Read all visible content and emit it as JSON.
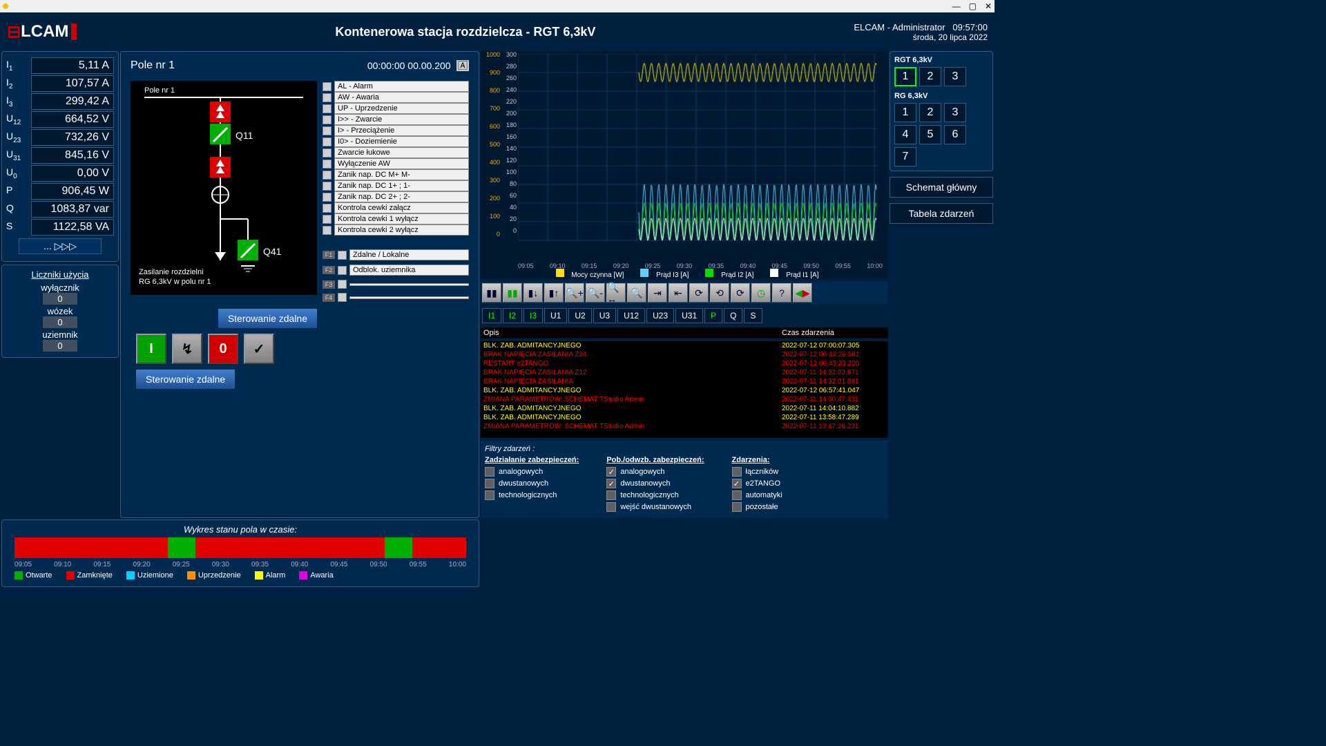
{
  "window": {
    "title": ""
  },
  "header": {
    "logo": "LCAM",
    "center": "Kontenerowa stacja rozdzielcza  - RGT 6,3kV",
    "user": "ELCAM - Administrator",
    "time": "09:57:00",
    "date": "środa, 20 lipca 2022"
  },
  "measurements": [
    {
      "lbl": "I",
      "sub": "1",
      "val": "5,11 A"
    },
    {
      "lbl": "I",
      "sub": "2",
      "val": "107,57 A"
    },
    {
      "lbl": "I",
      "sub": "3",
      "val": "299,42 A"
    },
    {
      "lbl": "U",
      "sub": "12",
      "val": "664,52 V"
    },
    {
      "lbl": "U",
      "sub": "23",
      "val": "732,26 V"
    },
    {
      "lbl": "U",
      "sub": "31",
      "val": "845,16 V"
    },
    {
      "lbl": "U",
      "sub": "0",
      "val": "0,00 V"
    },
    {
      "lbl": "P",
      "sub": "",
      "val": "906,45 W"
    },
    {
      "lbl": "Q",
      "sub": "",
      "val": "1083,87 var"
    },
    {
      "lbl": "S",
      "sub": "",
      "val": "1122,58 VA"
    }
  ],
  "more_btn": "... ▷▷▷",
  "liczniki": {
    "title": "Liczniki użycia",
    "items": [
      {
        "name": "wyłącznik",
        "val": "0"
      },
      {
        "name": "wózek",
        "val": "0"
      },
      {
        "name": "uziemnik",
        "val": "0"
      }
    ]
  },
  "pole": {
    "title": "Pole nr 1",
    "timer": "00:00:00  00.00.200",
    "sld_title": "Pole nr 1",
    "sld_sw1": "Q11",
    "sld_sw2": "Q41",
    "sld_caption1": "Zasilanie rozdzielni",
    "sld_caption2": "RG 6,3kV w polu nr 1",
    "signals": [
      "AL - Alarm",
      "AW - Awaria",
      "UP - Uprzedzenie",
      "I>> - Zwarcie",
      "I> - Przeciążenie",
      "I0> - Doziemienie",
      "Zwarcie łukowe",
      "Wyłączenie AW",
      "Zanik nap. DC  M+ M-",
      "Zanik nap. DC  1+ ; 1-",
      "Zanik nap. DC  2+ ; 2-",
      "Kontrola cewki załącz",
      "Kontrola cewki 1 wyłącz",
      "Kontrola cewki 2 wyłącz"
    ],
    "fkeys": [
      {
        "f": "F1",
        "txt": "Zdalne / Lokalne"
      },
      {
        "f": "F2",
        "txt": "Odblok. uziemnika"
      },
      {
        "f": "F3",
        "txt": ""
      },
      {
        "f": "F4",
        "txt": ""
      }
    ],
    "ctrl_btn1": "Sterowanie zdalne",
    "ctrl_btn2": "Sterowanie zdalne"
  },
  "timeline": {
    "title": "Wykres stanu pola w czasie:",
    "axis": [
      "09:05",
      "09:10",
      "09:15",
      "09:20",
      "09:25",
      "09:30",
      "09:35",
      "09:40",
      "09:45",
      "09:50",
      "09:55",
      "10:00"
    ],
    "legend": [
      {
        "c": "#00b000",
        "t": "Otwarte"
      },
      {
        "c": "#e00000",
        "t": "Zamknięte"
      },
      {
        "c": "#00d0ff",
        "t": "Uziemione"
      },
      {
        "c": "#ff9000",
        "t": "Uprzedzenie"
      },
      {
        "c": "#ffff00",
        "t": "Alarm"
      },
      {
        "c": "#e000e0",
        "t": "Awaria"
      }
    ],
    "segments": [
      {
        "c": "#e00000",
        "w": 34
      },
      {
        "c": "#00b000",
        "w": 6
      },
      {
        "c": "#e00000",
        "w": 42
      },
      {
        "c": "#00b000",
        "w": 6
      },
      {
        "c": "#e00000",
        "w": 12
      }
    ]
  },
  "chart_data": {
    "type": "line",
    "x_axis": [
      "09:05",
      "09:10",
      "09:15",
      "09:20",
      "09:25",
      "09:30",
      "09:35",
      "09:40",
      "09:45",
      "09:50",
      "09:55",
      "10:00"
    ],
    "y_left_ticks": [
      0,
      100,
      200,
      300,
      400,
      500,
      600,
      700,
      800,
      900,
      1000
    ],
    "y_right_ticks": [
      0,
      20,
      40,
      60,
      80,
      100,
      120,
      140,
      160,
      180,
      200,
      220,
      240,
      260,
      280,
      300
    ],
    "series": [
      {
        "name": "Mocy czynna [W]",
        "color": "#ffe000",
        "range": [
          850,
          950
        ]
      },
      {
        "name": "Prąd I3 [A]",
        "color": "#60d0ff",
        "range": [
          0,
          300
        ]
      },
      {
        "name": "Prąd I2 [A]",
        "color": "#00e000",
        "range": [
          0,
          200
        ]
      },
      {
        "name": "Prąd I1 [A]",
        "color": "#ffffff",
        "range": [
          0,
          120
        ]
      }
    ],
    "note": "oscillating waveforms from ~09:25 to 10:00"
  },
  "chart_legend": [
    {
      "c": "#ffe000",
      "t": "Mocy czynna [W]"
    },
    {
      "c": "#60d0ff",
      "t": "Prąd I3 [A]"
    },
    {
      "c": "#00e000",
      "t": "Prąd I2 [A]"
    },
    {
      "c": "#ffffff",
      "t": "Prąd I1 [A]"
    }
  ],
  "toolbar2": [
    "I1",
    "I2",
    "I3",
    "U1",
    "U2",
    "U3",
    "U12",
    "U23",
    "U31",
    "P",
    "Q",
    "S"
  ],
  "events": {
    "col1": "Opis",
    "col2": "Czas zdarzenia",
    "rows": [
      {
        "c": "y",
        "d": "BLK. ZAB. ADMITANCYJNEGO",
        "t": "2022-07-12 07:00:07.305"
      },
      {
        "c": "r",
        "d": "BRAK NAPIĘCIA ZASILANIA Z34",
        "t": "2022-07-12 06:43:26.581"
      },
      {
        "c": "r",
        "d": "RESTART e2TANGO",
        "t": "2022-07-12 06:43:23.220"
      },
      {
        "c": "r",
        "d": "BRAK NAPIĘCIA ZASILANIA Z12",
        "t": "2022-07-11 14:32:02.871"
      },
      {
        "c": "r",
        "d": "BRAK NAPIĘCIA ZASILANIA",
        "t": "2022-07-11 14:32:01.881"
      },
      {
        "c": "y",
        "d": "BLK. ZAB. ADMITANCYJNEGO",
        "t": "2022-07-12 06:57:41.047"
      },
      {
        "c": "r",
        "d": "ZMIANA PARAMETRÓW: SCHEMAT TStudio Admin",
        "t": "2022-07-11 14:00:47.431"
      },
      {
        "c": "y",
        "d": "BLK. ZAB. ADMITANCYJNEGO",
        "t": "2022-07-11 14:04:10.882"
      },
      {
        "c": "y",
        "d": "BLK. ZAB. ADMITANCYJNEGO",
        "t": "2022-07-11 13:58:47.289"
      },
      {
        "c": "r",
        "d": "ZMIANA PARAMETRÓW: SCHEMAT TStudio Admin",
        "t": "2022-07-11 13:47:26.231"
      }
    ]
  },
  "filters": {
    "title": "Filtry zdarzeń :",
    "cols": [
      {
        "h": "Zadziałanie zabezpieczeń:",
        "items": [
          {
            "t": "analogowych",
            "on": false
          },
          {
            "t": "dwustanowych",
            "on": false
          },
          {
            "t": "technologicznych",
            "on": false
          }
        ]
      },
      {
        "h": "Pob./odwzb. zabezpieczeń:",
        "items": [
          {
            "t": "analogowych",
            "on": true
          },
          {
            "t": "dwustanowych",
            "on": true
          },
          {
            "t": "technologicznych",
            "on": false
          },
          {
            "t": "wejść dwustanowych",
            "on": false
          }
        ]
      },
      {
        "h": "Zdarzenia:",
        "items": [
          {
            "t": "łączników",
            "on": false
          },
          {
            "t": "e2TANGO",
            "on": true
          },
          {
            "t": "automatyki",
            "on": false
          },
          {
            "t": "pozostałe",
            "on": false
          }
        ]
      }
    ]
  },
  "rightnav": {
    "g1_title": "RGT 6,3kV",
    "g1": [
      "1",
      "2",
      "3"
    ],
    "g2_title": "RG 6,3kV",
    "g2": [
      "1",
      "2",
      "3",
      "4",
      "5",
      "6",
      "7"
    ],
    "btn1": "Schemat główny",
    "btn2": "Tabela zdarzeń"
  }
}
